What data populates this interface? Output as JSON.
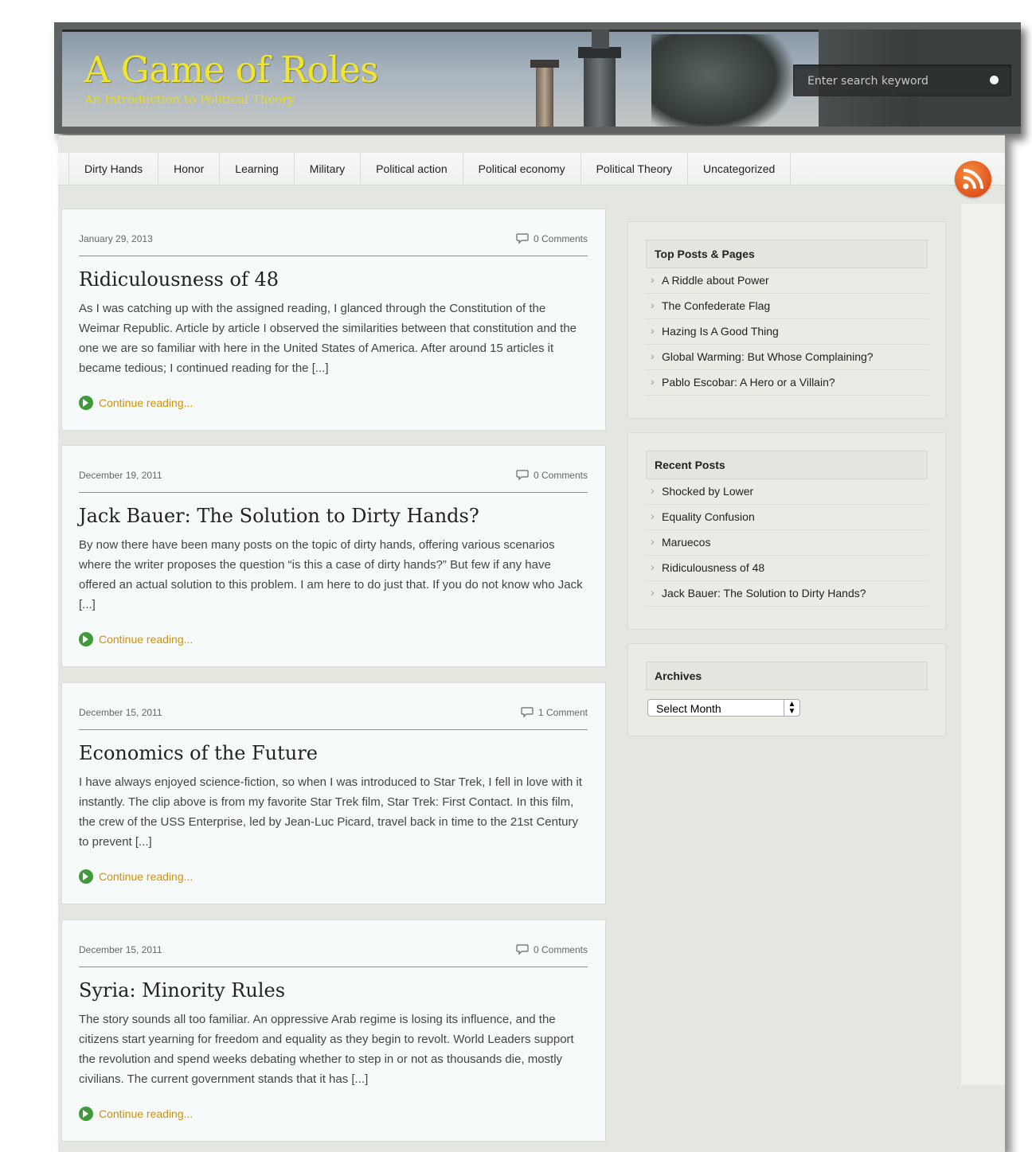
{
  "header": {
    "title": "A Game of Roles",
    "tagline": "An Introduction to Political Theory",
    "search_placeholder": "Enter search keyword"
  },
  "nav": {
    "items": [
      "Dirty Hands",
      "Honor",
      "Learning",
      "Military",
      "Political action",
      "Political economy",
      "Political Theory",
      "Uncategorized"
    ],
    "rss_icon": "rss-icon"
  },
  "posts": [
    {
      "date": "January 29, 2013",
      "comments": "0 Comments",
      "title": "Ridiculousness of 48",
      "excerpt": "As I was catching up with the assigned reading, I glanced through the Constitution of the Weimar Republic. Article by article I observed the similarities between that constitution and the one we are so familiar with here in the United States of America. After around 15 articles it became tedious; I continued reading for the [...]",
      "more": "Continue reading..."
    },
    {
      "date": "December 19, 2011",
      "comments": "0 Comments",
      "title": "Jack Bauer: The Solution to Dirty Hands?",
      "excerpt": "By now there have been many posts on the topic of dirty hands, offering various scenarios where the writer proposes the question “is this a case of dirty hands?” But few if any have offered an actual solution to this problem. I am here to do just that. If you do not know who Jack [...]",
      "more": "Continue reading..."
    },
    {
      "date": "December 15, 2011",
      "comments": "1 Comment",
      "title": "Economics of the Future",
      "excerpt": "I have always enjoyed science-fiction, so when I was introduced to Star Trek, I fell in love with it instantly. The clip above is from my favorite Star Trek film, Star Trek: First Contact. In this film, the crew of the USS Enterprise, led by Jean-Luc Picard, travel back in time to the 21st Century to prevent [...]",
      "more": "Continue reading..."
    },
    {
      "date": "December 15, 2011",
      "comments": "0 Comments",
      "title": "Syria: Minority Rules",
      "excerpt": "The story sounds all too familiar. An oppressive Arab regime is losing its influence, and the citizens start yearning for freedom and equality as they begin to revolt. World Leaders support the revolution and spend weeks debating whether to step in or not as thousands die, mostly civilians. The current government stands that it has [...]",
      "more": "Continue reading..."
    }
  ],
  "sidebar": {
    "top_posts": {
      "title": "Top Posts & Pages",
      "items": [
        "A Riddle about Power",
        "The Confederate Flag",
        "Hazing Is A Good Thing",
        "Global Warming: But Whose Complaining?",
        "Pablo Escobar: A Hero or a Villain?"
      ]
    },
    "recent_posts": {
      "title": "Recent Posts",
      "items": [
        "Shocked by Lower",
        "Equality Confusion",
        "Maruecos",
        "Ridiculousness of 48",
        "Jack Bauer: The Solution to Dirty Hands?"
      ]
    },
    "archives": {
      "title": "Archives",
      "select_value": "Select Month"
    }
  },
  "colors": {
    "title_yellow": "#f2e62a",
    "link_orange": "#d69000",
    "continue_green": "#3f9b37",
    "rss_orange": "#e0531e"
  }
}
